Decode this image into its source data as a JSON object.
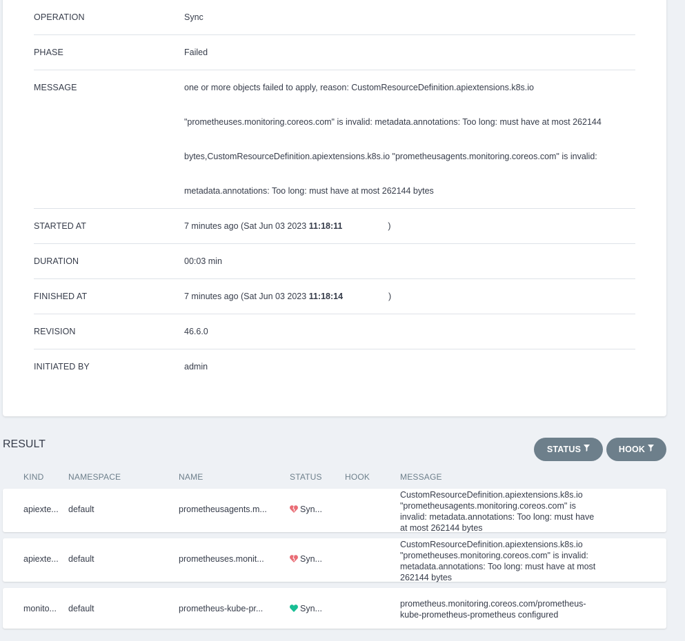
{
  "operation": {
    "rows": [
      {
        "key": "OPERATION",
        "value": "Sync"
      },
      {
        "key": "PHASE",
        "value": "Failed"
      },
      {
        "key": "MESSAGE",
        "lines": [
          "one or more objects failed to apply, reason: CustomResourceDefinition.apiextensions.k8s.io",
          "\"prometheuses.monitoring.coreos.com\" is invalid: metadata.annotations: Too long: must have at most 262144",
          "bytes,CustomResourceDefinition.apiextensions.k8s.io \"prometheusagents.monitoring.coreos.com\" is invalid:",
          "metadata.annotations: Too long: must have at most 262144 bytes"
        ]
      },
      {
        "key": "STARTED AT",
        "prefix": "7 minutes ago (Sat Jun 03 2023 ",
        "time": "11:18:11",
        "suffix": ")"
      },
      {
        "key": "DURATION",
        "value": "00:03 min"
      },
      {
        "key": "FINISHED AT",
        "prefix": "7 minutes ago (Sat Jun 03 2023 ",
        "time": "11:18:14",
        "suffix": ")"
      },
      {
        "key": "REVISION",
        "value": "46.6.0"
      },
      {
        "key": "INITIATED BY",
        "value": "admin"
      }
    ]
  },
  "result": {
    "title": "RESULT",
    "filters": {
      "status": "STATUS",
      "hook": "HOOK"
    },
    "columns": {
      "kind": "KIND",
      "namespace": "NAMESPACE",
      "name": "NAME",
      "status": "STATUS",
      "hook": "HOOK",
      "message": "MESSAGE"
    },
    "rows": [
      {
        "kind": "apiexte...",
        "namespace": "default",
        "name": "prometheusagents.m...",
        "status": "Syn...",
        "status_color": "#e96d76",
        "message_lines": [
          "CustomResourceDefinition.apiextensions.k8s.io",
          "\"prometheusagents.monitoring.coreos.com\" is",
          "invalid: metadata.annotations: Too long: must have",
          "at most 262144 bytes"
        ]
      },
      {
        "kind": "apiexte...",
        "namespace": "default",
        "name": "prometheuses.monit...",
        "status": "Syn...",
        "status_color": "#e96d76",
        "message_lines": [
          "CustomResourceDefinition.apiextensions.k8s.io",
          "\"prometheuses.monitoring.coreos.com\" is invalid:",
          "metadata.annotations: Too long: must have at most",
          "262144 bytes"
        ]
      },
      {
        "kind": "monito...",
        "namespace": "default",
        "name": "prometheus-kube-pr...",
        "status": "Syn...",
        "status_color": "#18be94",
        "message_lines": [
          "prometheus.monitoring.coreos.com/prometheus-",
          "kube-prometheus-prometheus configured"
        ]
      }
    ]
  }
}
